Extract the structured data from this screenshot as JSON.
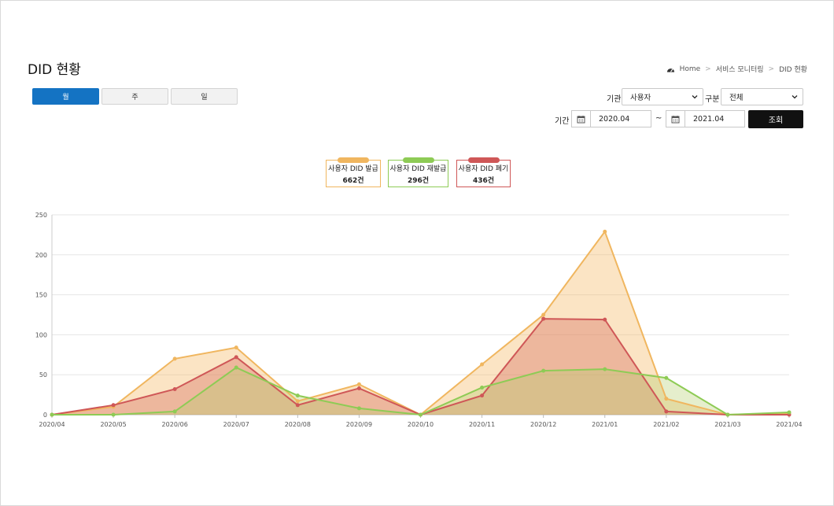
{
  "page": {
    "title": "DID 현황"
  },
  "breadcrumb": {
    "home": "Home",
    "section": "서비스 모니터링",
    "current": "DID 현황",
    "separator": ">"
  },
  "tabs": [
    {
      "label": "월",
      "active": true
    },
    {
      "label": "주",
      "active": false
    },
    {
      "label": "일",
      "active": false
    }
  ],
  "filters": {
    "org_label": "기관",
    "org_value": "사용자",
    "type_label": "구분",
    "type_value": "전체",
    "period_label": "기간",
    "start": "2020.04",
    "range_sep": "~",
    "end": "2021.04",
    "search_label": "조회"
  },
  "legend": [
    {
      "name": "사용자 DID 발급",
      "count": "662건",
      "color": "#f0b65f"
    },
    {
      "name": "사용자 DID 재발급",
      "count": "296건",
      "color": "#8ecb55"
    },
    {
      "name": "사용자 DID 폐기",
      "count": "436건",
      "color": "#cf5757"
    }
  ],
  "chart_data": {
    "type": "area",
    "categories": [
      "2020/04",
      "2020/05",
      "2020/06",
      "2020/07",
      "2020/08",
      "2020/09",
      "2020/10",
      "2020/11",
      "2020/12",
      "2021/01",
      "2021/02",
      "2021/03",
      "2021/04"
    ],
    "ylim": [
      0,
      250
    ],
    "yticks": [
      0,
      50,
      100,
      150,
      200,
      250
    ],
    "grid": true,
    "series": [
      {
        "name": "사용자 DID 발급",
        "color": "#f0b65f",
        "fill": "rgba(245,185,100,0.38)",
        "values": [
          0,
          10,
          70,
          84,
          17,
          38,
          0,
          63,
          125,
          229,
          20,
          0,
          2
        ]
      },
      {
        "name": "사용자 DID 폐기",
        "color": "#cf5757",
        "fill": "rgba(215,110,95,0.38)",
        "values": [
          0,
          12,
          32,
          72,
          12,
          33,
          0,
          24,
          120,
          119,
          4,
          0,
          0
        ]
      },
      {
        "name": "사용자 DID 재발급",
        "color": "#8ecb55",
        "fill": "rgba(180,205,110,0.35)",
        "values": [
          0,
          0,
          4,
          59,
          24,
          8,
          0,
          34,
          55,
          57,
          46,
          0,
          3
        ]
      }
    ]
  }
}
